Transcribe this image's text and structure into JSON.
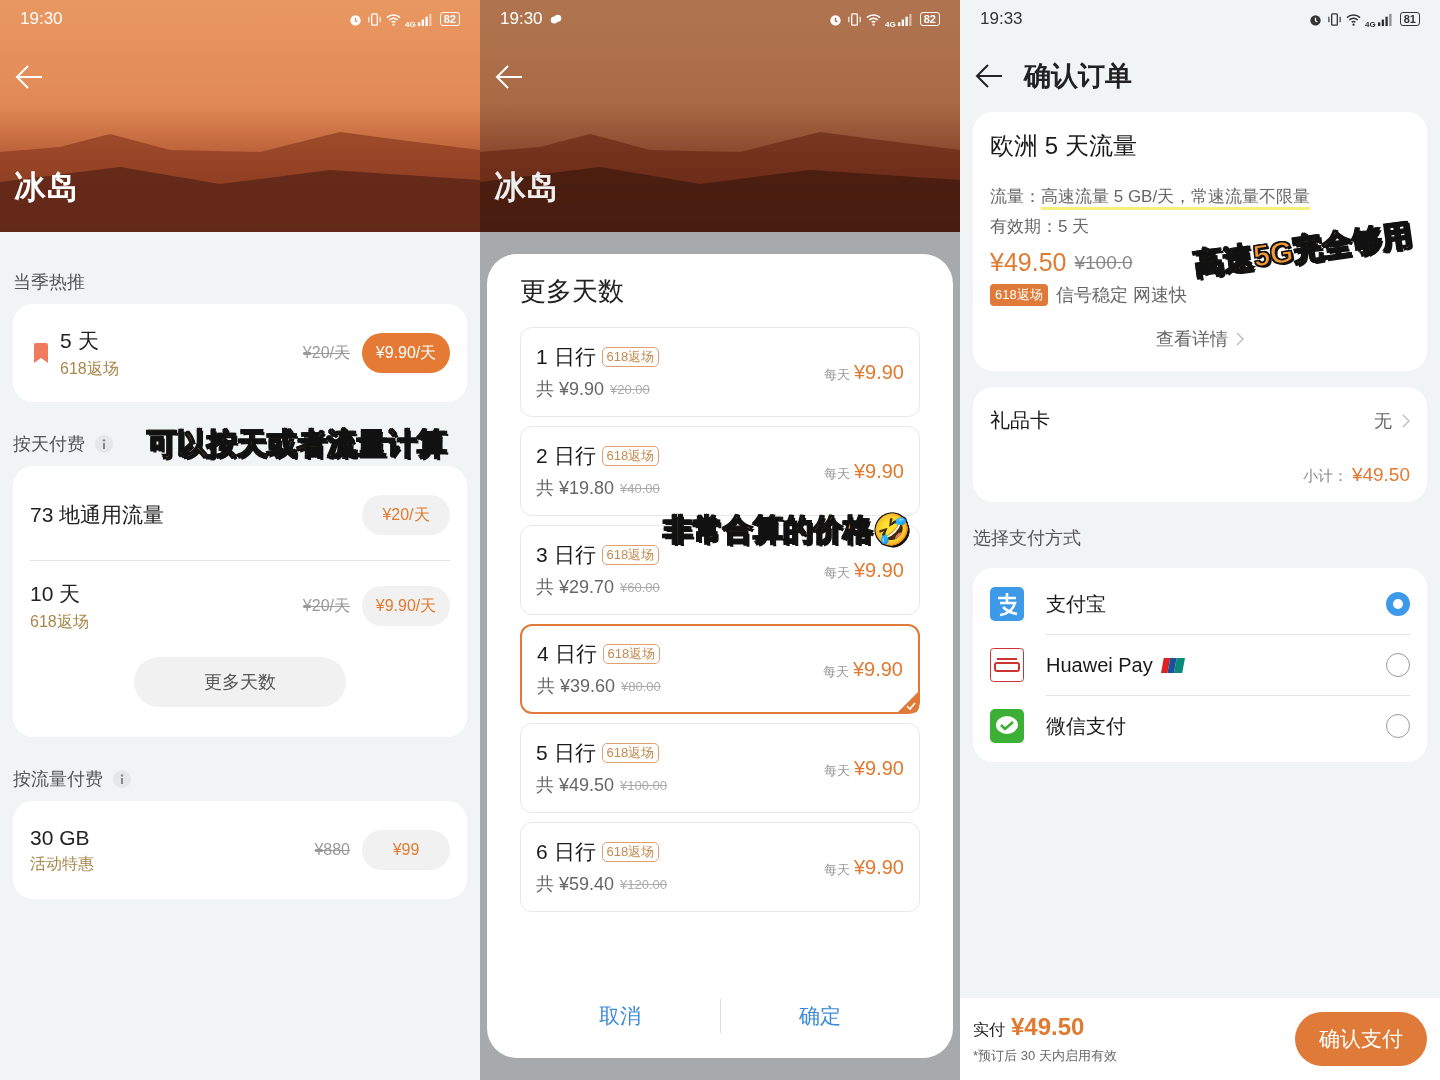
{
  "destination_page": {
    "status_bar": {
      "time": "19:30",
      "network": "4G",
      "battery": "82"
    },
    "title": "冰岛",
    "sections": [
      {
        "heading": "当季热推",
        "info": false,
        "items": [
          {
            "name": "5 天",
            "tag": "618返场",
            "old_price": "¥20/天",
            "price": "¥9.90/天",
            "featured": true
          }
        ]
      },
      {
        "heading": "按天付费",
        "info": true,
        "sticker": "可以按天或者流量计算",
        "items": [
          {
            "name": "73 地通用流量",
            "price": "¥20/天",
            "featured": false
          },
          {
            "name": "10 天",
            "tag": "618返场",
            "old_price": "¥20/天",
            "price": "¥9.90/天",
            "featured": false
          }
        ],
        "more_button": "更多天数"
      },
      {
        "heading": "按流量付费",
        "info": true,
        "items": [
          {
            "name": "30 GB",
            "tag": "活动特惠",
            "old_price": "¥880",
            "price": "¥99",
            "featured": false
          }
        ]
      }
    ]
  },
  "day_picker_page": {
    "status_bar": {
      "time": "19:30",
      "network": "4G",
      "battery": "82"
    },
    "title": "冰岛",
    "sheet": {
      "title": "更多天数",
      "sticker": "非常合算的价格🤣",
      "options": [
        {
          "name": "1 日行",
          "tag": "618返场",
          "total": "共 ¥9.90",
          "old_total": "¥20.00",
          "per_day_label": "每天",
          "per_day": "¥9.90",
          "selected": false
        },
        {
          "name": "2 日行",
          "tag": "618返场",
          "total": "共 ¥19.80",
          "old_total": "¥40.00",
          "per_day_label": "每天",
          "per_day": "¥9.90",
          "selected": false
        },
        {
          "name": "3 日行",
          "tag": "618返场",
          "total": "共 ¥29.70",
          "old_total": "¥60.00",
          "per_day_label": "每天",
          "per_day": "¥9.90",
          "selected": false
        },
        {
          "name": "4 日行",
          "tag": "618返场",
          "total": "共 ¥39.60",
          "old_total": "¥80.00",
          "per_day_label": "每天",
          "per_day": "¥9.90",
          "selected": true
        },
        {
          "name": "5 日行",
          "tag": "618返场",
          "total": "共 ¥49.50",
          "old_total": "¥100.00",
          "per_day_label": "每天",
          "per_day": "¥9.90",
          "selected": false
        },
        {
          "name": "6 日行",
          "tag": "618返场",
          "total": "共 ¥59.40",
          "old_total": "¥120.00",
          "per_day_label": "每天",
          "per_day": "¥9.90",
          "selected": false
        }
      ],
      "cancel": "取消",
      "confirm": "确定"
    }
  },
  "order_page": {
    "status_bar": {
      "time": "19:33",
      "network": "4G",
      "battery": "81"
    },
    "title": "确认订单",
    "product": {
      "name": "欧洲 5 天流量",
      "lines": [
        {
          "label": "流量：",
          "value": "高速流量 5 GB/天，常速流量不限量",
          "highlighted": true
        },
        {
          "label": "有效期：",
          "value": "5 天",
          "highlighted": false
        }
      ],
      "price": "¥49.50",
      "old_price": "¥100.0",
      "tag": "618返场",
      "slogan": "信号稳定 网速快",
      "details_link": "查看详情",
      "sticker": "高速5G完全够用"
    },
    "gift_card": {
      "label": "礼品卡",
      "value": "无",
      "subtotal_label": "小计：",
      "subtotal": "¥49.50"
    },
    "payment": {
      "heading": "选择支付方式",
      "methods": [
        {
          "kind": "alipay",
          "name": "支付宝",
          "selected": true
        },
        {
          "kind": "huawei",
          "name": "Huawei Pay",
          "selected": false
        },
        {
          "kind": "wechat",
          "name": "微信支付",
          "selected": false
        }
      ]
    },
    "footer": {
      "paid_label": "实付",
      "paid": "¥49.50",
      "note": "*预订后 30 天内启用有效",
      "button": "确认支付"
    }
  }
}
